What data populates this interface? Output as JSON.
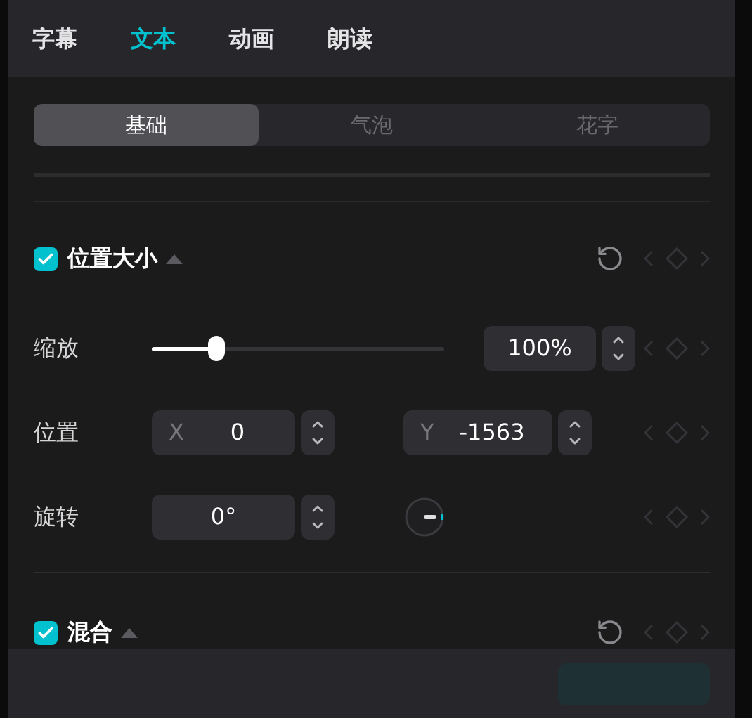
{
  "tabs": [
    {
      "label": "字幕",
      "selected": false
    },
    {
      "label": "文本",
      "selected": true
    },
    {
      "label": "动画",
      "selected": false
    },
    {
      "label": "朗读",
      "selected": false
    }
  ],
  "subtabs": [
    {
      "label": "基础",
      "selected": true
    },
    {
      "label": "气泡",
      "selected": false
    },
    {
      "label": "花字",
      "selected": false
    }
  ],
  "sections": [
    {
      "title": "位置大小",
      "checked": true,
      "expanded": true,
      "rows": [
        {
          "kind": "slider",
          "label": "缩放",
          "level": 0.22,
          "value": "100%"
        },
        {
          "kind": "xy",
          "label": "位置",
          "x_label": "X",
          "x_value": "0",
          "y_label": "Y",
          "y_value": "-1563"
        },
        {
          "kind": "rotation",
          "label": "旋转",
          "value": "0°"
        }
      ]
    },
    {
      "title": "混合",
      "checked": true,
      "expanded": true
    }
  ]
}
